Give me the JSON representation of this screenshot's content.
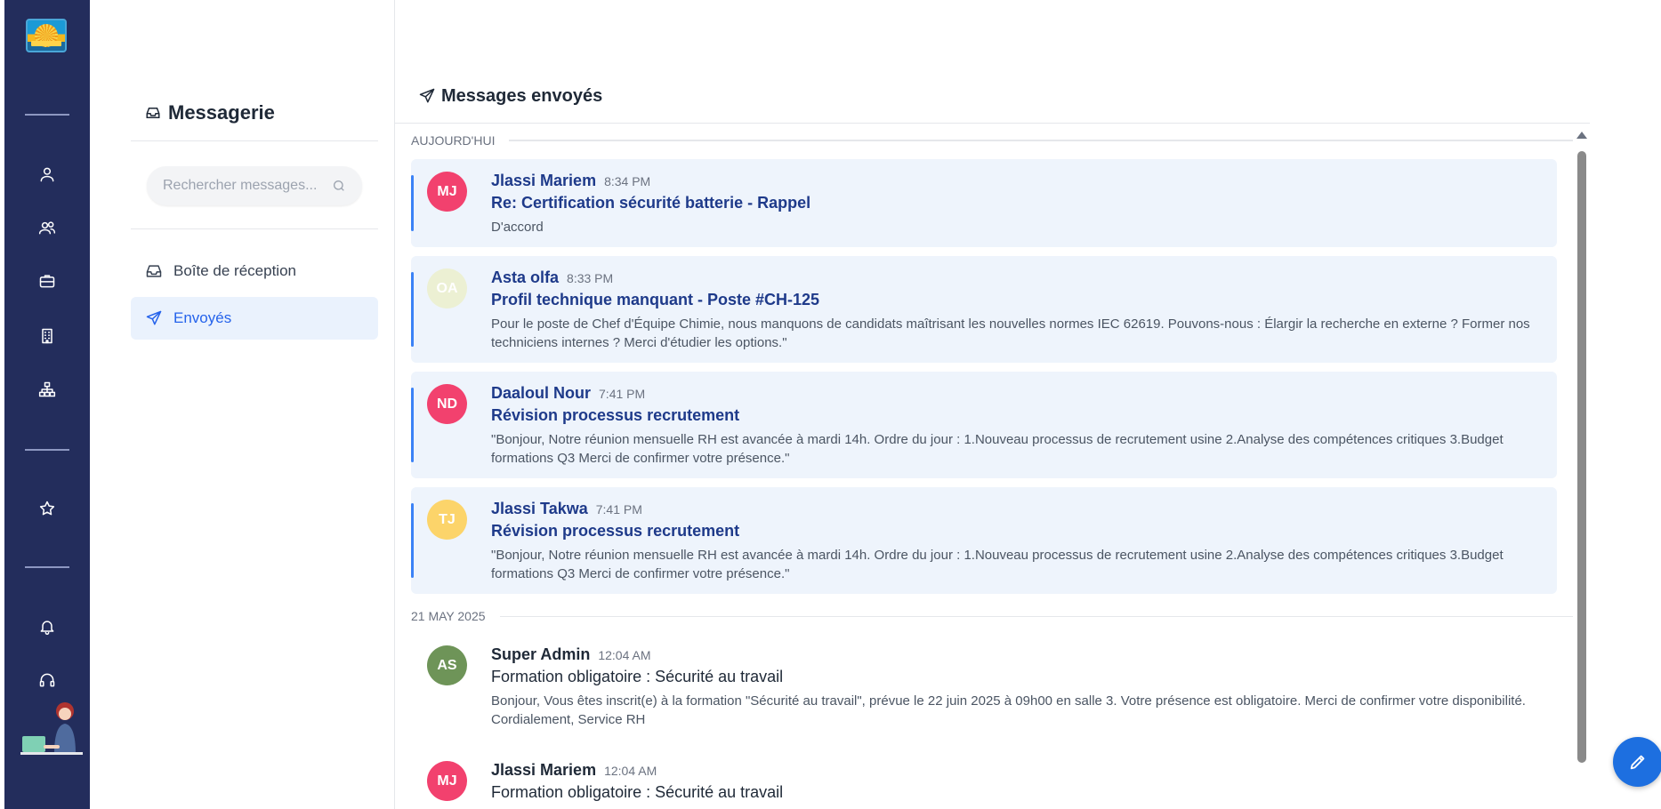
{
  "panel": {
    "title": "Messagerie",
    "search_placeholder": "Rechercher messages...",
    "nav": [
      {
        "label": "Boîte de réception",
        "icon": "inbox-icon",
        "active": false
      },
      {
        "label": "Envoyés",
        "icon": "send-icon",
        "active": true
      }
    ]
  },
  "main": {
    "title": "Messages envoyés",
    "groups": [
      {
        "date": "AUJOURD'HUI",
        "messages": [
          {
            "initials": "MJ",
            "avatar_color": "#f2416e",
            "sender": "Jlassi Mariem",
            "time": "8:34 PM",
            "subject": "Re: Certification sécurité batterie - Rappel",
            "preview": "D'accord",
            "unread": true
          },
          {
            "initials": "OA",
            "avatar_color": "#ecf0d3",
            "sender": "Asta olfa",
            "time": "8:33 PM",
            "subject": "Profil technique manquant - Poste #CH-125",
            "preview": "Pour le poste de Chef d'Équipe Chimie, nous manquons de candidats maîtrisant les nouvelles normes IEC 62619. Pouvons-nous : Élargir la recherche en externe ? Former nos techniciens internes ? Merci d'étudier les options.\"",
            "unread": true
          },
          {
            "initials": "ND",
            "avatar_color": "#f2416e",
            "sender": "Daaloul Nour",
            "time": "7:41 PM",
            "subject": "Révision processus recrutement",
            "preview": "\"Bonjour, Notre réunion mensuelle RH est avancée à mardi 14h. Ordre du jour : 1.Nouveau processus de recrutement usine 2.Analyse des compétences critiques 3.Budget formations Q3 Merci de confirmer votre présence.\"",
            "unread": true
          },
          {
            "initials": "TJ",
            "avatar_color": "#fcd46a",
            "sender": "Jlassi Takwa",
            "time": "7:41 PM",
            "subject": "Révision processus recrutement",
            "preview": "\"Bonjour, Notre réunion mensuelle RH est avancée à mardi 14h. Ordre du jour : 1.Nouveau processus de recrutement usine 2.Analyse des compétences critiques 3.Budget formations Q3 Merci de confirmer votre présence.\"",
            "unread": true
          }
        ]
      },
      {
        "date": "21 MAY 2025",
        "messages": [
          {
            "initials": "AS",
            "avatar_color": "#6e9458",
            "sender": "Super Admin",
            "time": "12:04 AM",
            "subject": "Formation obligatoire : Sécurité au travail",
            "preview": "Bonjour, Vous êtes inscrit(e) à la formation \"Sécurité au travail\", prévue le 22 juin 2025 à 09h00 en salle 3. Votre présence est obligatoire. Merci de confirmer votre disponibilité. Cordialement, Service RH",
            "unread": false
          },
          {
            "initials": "MJ",
            "avatar_color": "#f2416e",
            "sender": "Jlassi Mariem",
            "time": "12:04 AM",
            "subject": "Formation obligatoire : Sécurité au travail",
            "preview": "",
            "unread": false
          }
        ]
      }
    ]
  }
}
